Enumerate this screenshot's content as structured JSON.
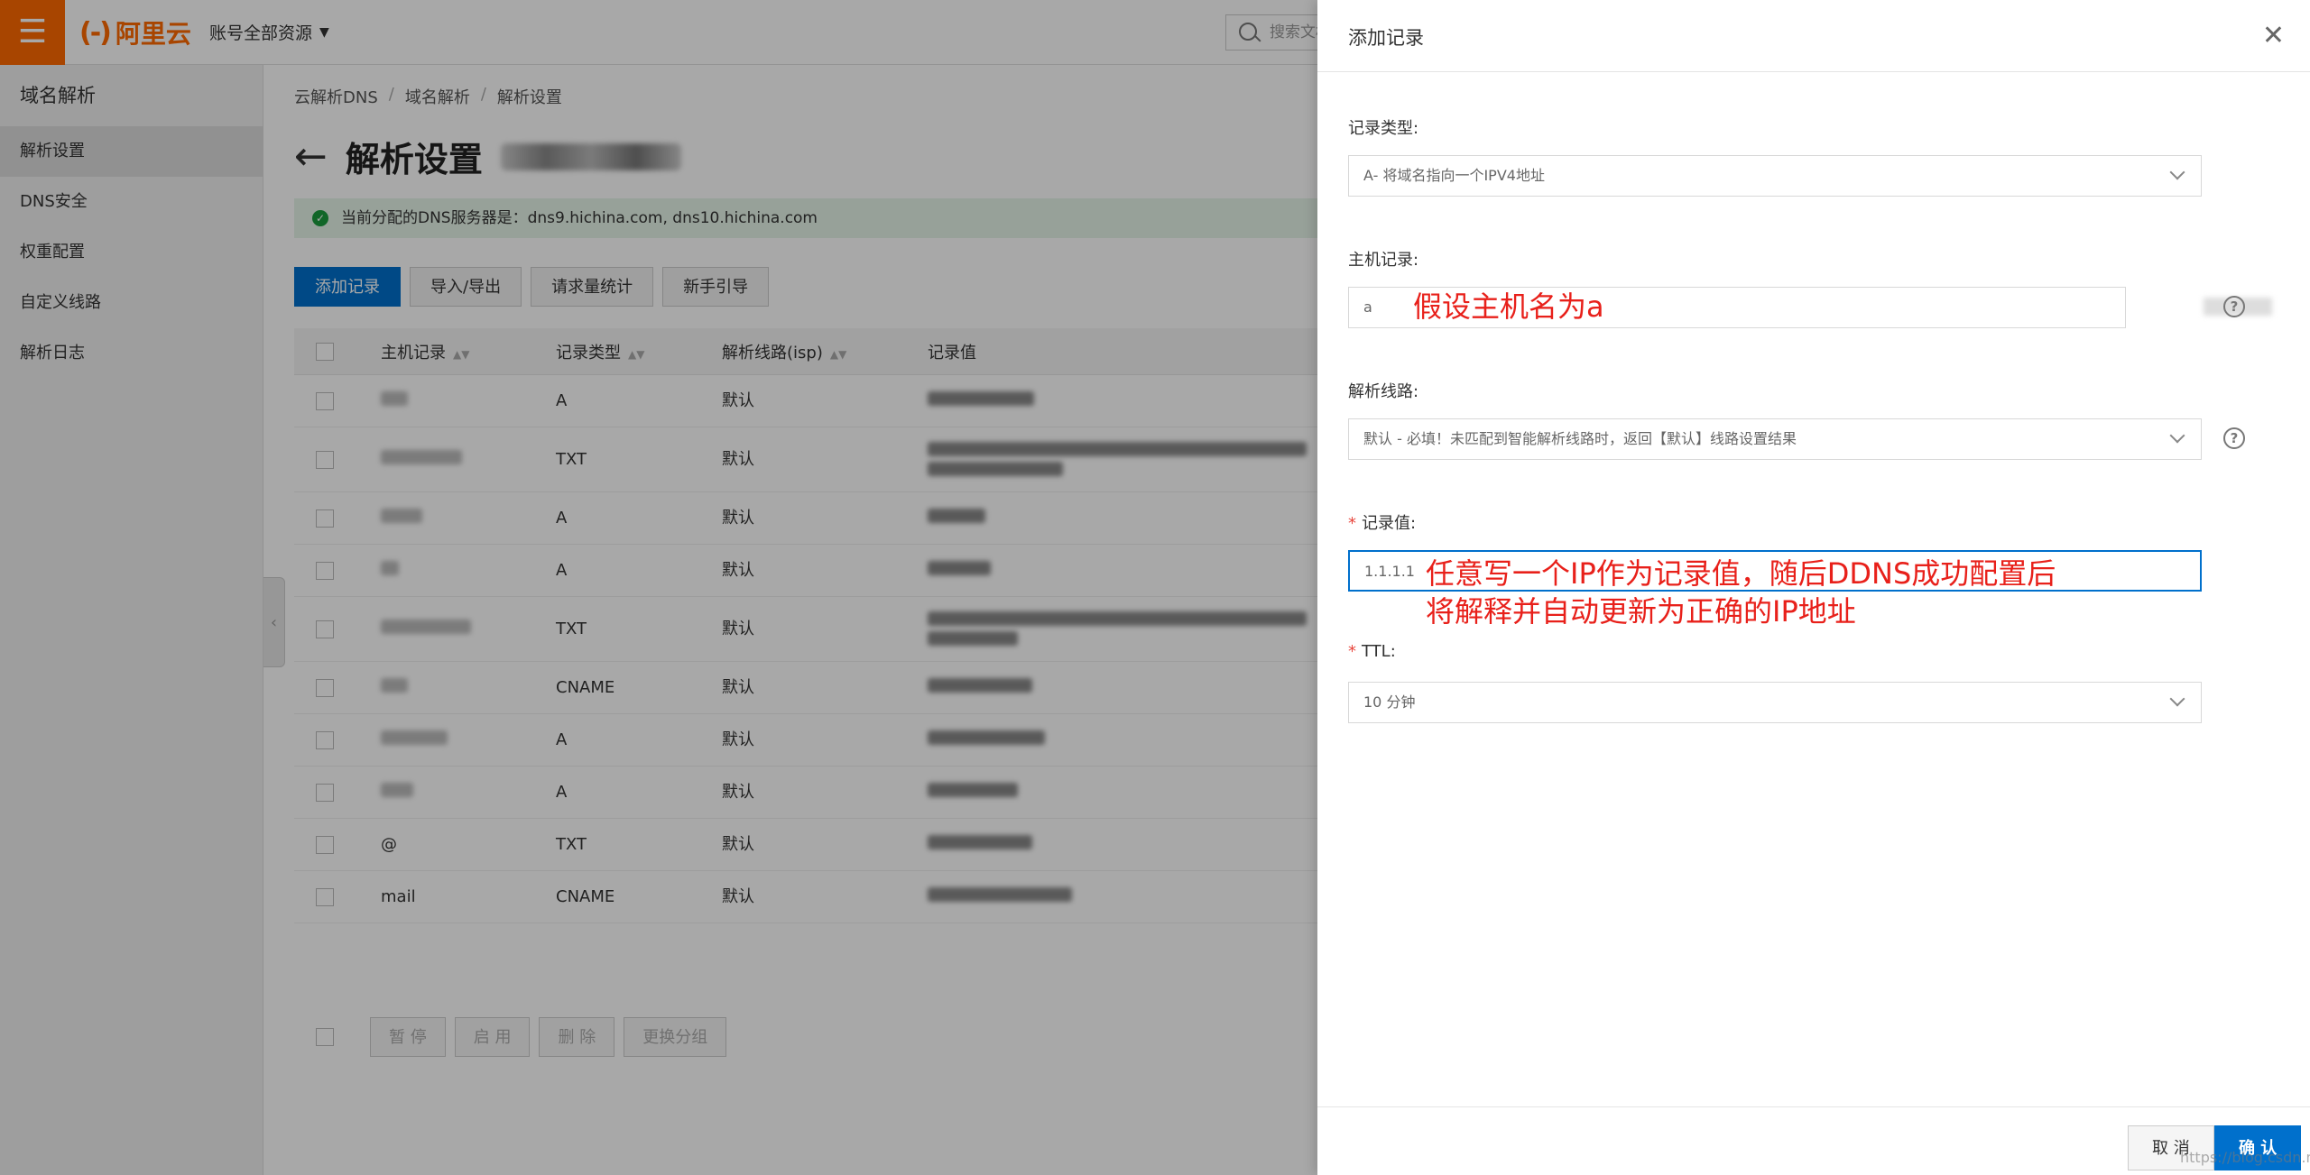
{
  "topbar": {
    "logo_text": "阿里云",
    "logo_bracket": "(-)",
    "account": "账号全部资源",
    "search_placeholder": "搜索文档"
  },
  "sidebar": {
    "title": "域名解析",
    "items": [
      {
        "label": "解析设置",
        "active": true
      },
      {
        "label": "DNS安全"
      },
      {
        "label": "权重配置"
      },
      {
        "label": "自定义线路"
      },
      {
        "label": "解析日志"
      }
    ]
  },
  "breadcrumb": [
    "云解析DNS",
    "域名解析",
    "解析设置"
  ],
  "page": {
    "title": "解析设置",
    "dns_notice": "当前分配的DNS服务器是：dns9.hichina.com, dns10.hichina.com"
  },
  "toolbar": {
    "add": "添加记录",
    "import_export": "导入/导出",
    "stats": "请求量统计",
    "guide": "新手引导"
  },
  "table": {
    "headers": [
      "主机记录",
      "记录类型",
      "解析线路(isp)",
      "记录值"
    ],
    "rows": [
      {
        "host": "",
        "type": "A",
        "line": "默认"
      },
      {
        "host": "",
        "type": "TXT",
        "line": "默认"
      },
      {
        "host": "",
        "type": "A",
        "line": "默认"
      },
      {
        "host": "",
        "type": "A",
        "line": "默认"
      },
      {
        "host": "",
        "type": "TXT",
        "line": "默认"
      },
      {
        "host": "",
        "type": "CNAME",
        "line": "默认"
      },
      {
        "host": "",
        "type": "A",
        "line": "默认"
      },
      {
        "host": "",
        "type": "A",
        "line": "默认"
      },
      {
        "host": "@",
        "type": "TXT",
        "line": "默认"
      },
      {
        "host": "mail",
        "type": "CNAME",
        "line": "默认"
      }
    ]
  },
  "bulk": {
    "pause": "暂 停",
    "enable": "启 用",
    "delete": "删 除",
    "regroup": "更换分组"
  },
  "drawer": {
    "title": "添加记录",
    "record_type_label": "记录类型:",
    "record_type_value": "A- 将域名指向一个IPV4地址",
    "host_label": "主机记录:",
    "host_value": "a",
    "host_annotation": "假设主机名为a",
    "line_label": "解析线路:",
    "line_value": "默认 - 必填！未匹配到智能解析线路时，返回【默认】线路设置结果",
    "value_label": "记录值:",
    "value_value": "1.1.1.1",
    "value_annotation_1": "任意写一个IP作为记录值，随后DDNS成功配置后",
    "value_annotation_2": "将解释并自动更新为正确的IP地址",
    "ttl_label": "TTL:",
    "ttl_value": "10 分钟",
    "cancel": "取 消",
    "confirm": "确 认",
    "watermark": "https://blog.csdn.net/pzhi"
  },
  "colors": {
    "brand": "#ff6a00",
    "primary": "#0070cc",
    "annotation": "#e8201a",
    "success": "#1a9c3e"
  }
}
